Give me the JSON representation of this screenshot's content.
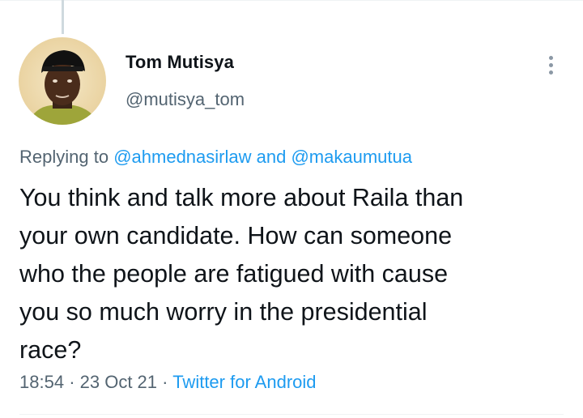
{
  "tweet": {
    "author": {
      "display_name": "Tom Mutisya",
      "handle": "@mutisya_tom",
      "avatar_icon": "user-avatar-photo"
    },
    "more_icon": "more-options-icon",
    "replying": {
      "prefix": "Replying to",
      "mention_1": "@ahmednasirlaw",
      "conjunction": "and",
      "mention_2": "@makaumutua"
    },
    "text": "You think and talk more about Raila than\nyour own candidate. How can someone\nwho the people are fatigued with cause\nyou so much worry in the presidential\nrace?",
    "meta": {
      "time": "18:54",
      "separator": "·",
      "date": "23 Oct 21",
      "source": "Twitter for Android"
    },
    "colors": {
      "accent": "#1d9bf0",
      "secondary_text": "#536471",
      "primary_text": "#0f1419"
    }
  }
}
